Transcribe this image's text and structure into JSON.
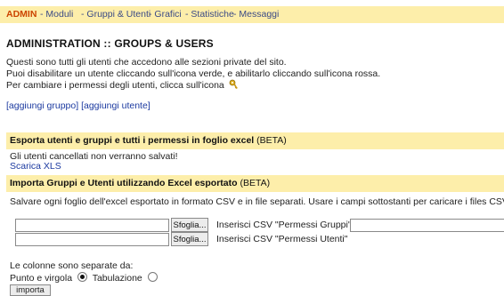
{
  "nav": {
    "items": [
      {
        "label": "ADMIN"
      },
      {
        "label": "- Moduli"
      },
      {
        "label": "- Gruppi & Utenti"
      },
      {
        "label": "- Grafici"
      },
      {
        "label": "- Statistiche"
      },
      {
        "label": "- Messaggi"
      }
    ],
    "active_color": "#cc4400",
    "link_color": "#3a4a86",
    "bar_color": "#fdeeaa"
  },
  "page": {
    "title": "ADMINISTRATION :: GROUPS & USERS",
    "intro": [
      "Questi sono tutti gli utenti che accedono alle sezioni private del sito.",
      "Puoi disabilitare un utente cliccando sull'icona verde, e abilitarlo cliccando sull'icona rossa.",
      "Per cambiare i permessi degli utenti, clicca sull'icona"
    ],
    "permissions_icon": "key-icon"
  },
  "actions": {
    "add_group": "[aggiungi gruppo]",
    "add_user": "[aggiungi utente]"
  },
  "export": {
    "heading": "Esporta utenti e gruppi e tutti i permessi in foglio excel",
    "beta": "(BETA)",
    "warning": "Gli utenti cancellati non verranno salvati!",
    "download": "Scarica XLS"
  },
  "import": {
    "heading": "Importa Gruppi e Utenti utilizzando Excel esportato",
    "beta": "(BETA)",
    "instructions": "Salvare ogni foglio dell'excel esportato in formato CSV e in file separati. Usare i campi sottostanti per caricare i files CSV.",
    "browse_label": "Sfoglia...",
    "csv_groups_label": "Inserisci CSV \"Permessi Gruppi\"",
    "csv_users_label": "Inserisci CSV \"Permessi Utenti\"",
    "separator_note": "Le colonne sono separate da:",
    "opt_semicolon": "Punto e virgola",
    "opt_tab": "Tabulazione",
    "selected": "semicolon",
    "submit": "importa"
  }
}
